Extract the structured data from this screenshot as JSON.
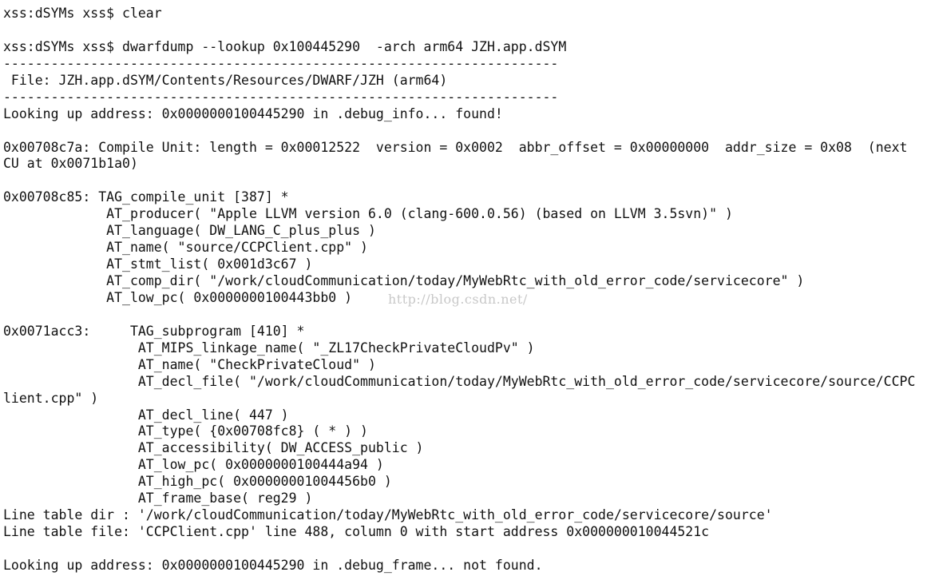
{
  "terminal": {
    "lines": [
      "xss:dSYMs xss$ clear",
      "",
      "xss:dSYMs xss$ dwarfdump --lookup 0x100445290  -arch arm64 JZH.app.dSYM",
      "----------------------------------------------------------------------",
      " File: JZH.app.dSYM/Contents/Resources/DWARF/JZH (arm64)",
      "----------------------------------------------------------------------",
      "Looking up address: 0x0000000100445290 in .debug_info... found!",
      "",
      "0x00708c7a: Compile Unit: length = 0x00012522  version = 0x0002  abbr_offset = 0x00000000  addr_size = 0x08  (next",
      "CU at 0x0071b1a0)",
      "",
      "0x00708c85: TAG_compile_unit [387] *",
      "             AT_producer( \"Apple LLVM version 6.0 (clang-600.0.56) (based on LLVM 3.5svn)\" )",
      "             AT_language( DW_LANG_C_plus_plus )",
      "             AT_name( \"source/CCPClient.cpp\" )",
      "             AT_stmt_list( 0x001d3c67 )",
      "             AT_comp_dir( \"/work/cloudCommunication/today/MyWebRtc_with_old_error_code/servicecore\" )",
      "             AT_low_pc( 0x0000000100443bb0 )",
      "",
      "0x0071acc3:     TAG_subprogram [410] *",
      "                 AT_MIPS_linkage_name( \"_ZL17CheckPrivateCloudPv\" )",
      "                 AT_name( \"CheckPrivateCloud\" )",
      "                 AT_decl_file( \"/work/cloudCommunication/today/MyWebRtc_with_old_error_code/servicecore/source/CCPC",
      "lient.cpp\" )",
      "                 AT_decl_line( 447 )",
      "                 AT_type( {0x00708fc8} ( * ) )",
      "                 AT_accessibility( DW_ACCESS_public )",
      "                 AT_low_pc( 0x0000000100444a94 )",
      "                 AT_high_pc( 0x00000001004456b0 )",
      "                 AT_frame_base( reg29 )",
      "Line table dir : '/work/cloudCommunication/today/MyWebRtc_with_old_error_code/servicecore/source'",
      "Line table file: 'CCPClient.cpp' line 488, column 0 with start address 0x000000010044521c",
      "",
      "Looking up address: 0x0000000100445290 in .debug_frame... not found."
    ],
    "watermark": "http://blog.csdn.net/"
  }
}
